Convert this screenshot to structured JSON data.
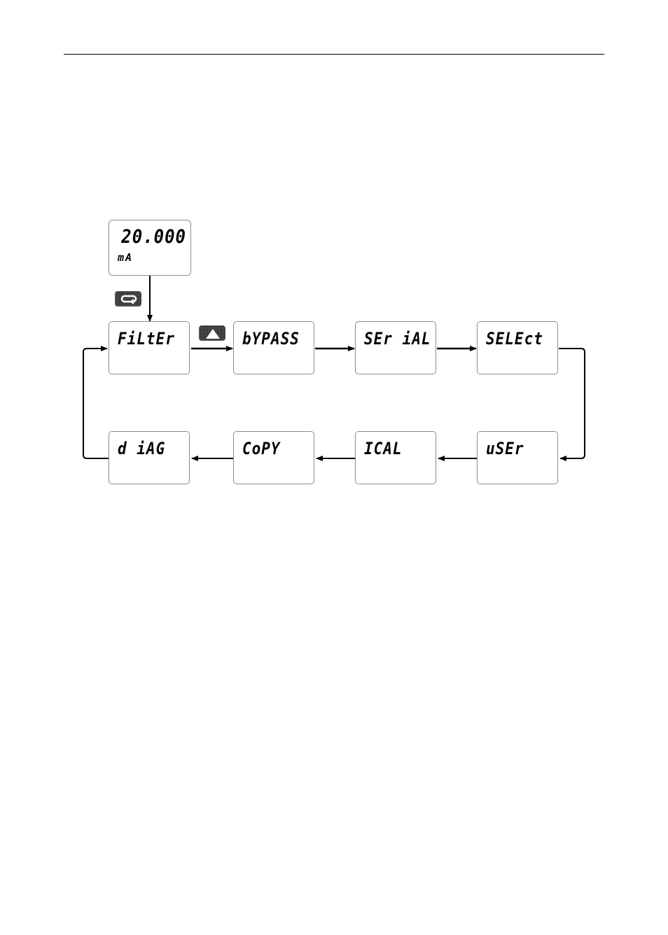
{
  "display": {
    "value": "20.000",
    "unit": "mA"
  },
  "keys": {
    "enter_key": "enter-key",
    "up_key": "up-arrow-key"
  },
  "menu": {
    "items": [
      {
        "label": "FiLtEr"
      },
      {
        "label": "bYPASS"
      },
      {
        "label": "SEr iAL"
      },
      {
        "label": "SELEct"
      },
      {
        "label": "uSEr"
      },
      {
        "label": "ICAL"
      },
      {
        "label": "CoPY"
      },
      {
        "label": "d iAG"
      }
    ]
  },
  "colors": {
    "line": "#000000",
    "box_border": "#8c8c8c",
    "key_fill": "#1a1a1a"
  }
}
